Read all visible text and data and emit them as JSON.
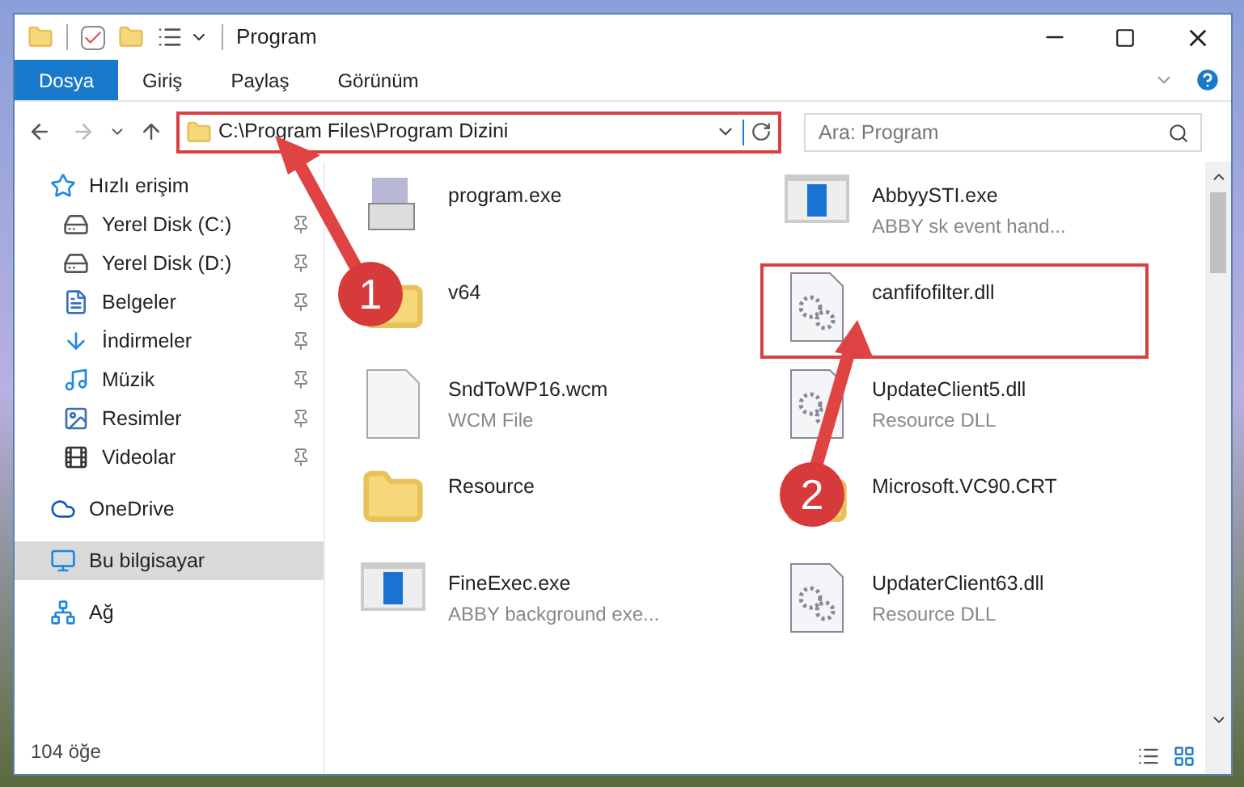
{
  "window": {
    "title": "Program"
  },
  "ribbon_tabs": [
    {
      "label": "Dosya",
      "selected": true
    },
    {
      "label": "Giriş",
      "selected": false
    },
    {
      "label": "Paylaş",
      "selected": false
    },
    {
      "label": "Görünüm",
      "selected": false
    }
  ],
  "address": {
    "path": "C:\\Program Files\\Program Dizini"
  },
  "search": {
    "placeholder": "Ara: Program"
  },
  "sidebar": {
    "items": [
      {
        "label": "Hızlı erişim",
        "kind": "star",
        "selected": false,
        "children": [
          {
            "label": "Yerel Disk (C:)",
            "kind": "disk",
            "pinned": true,
            "selected": false
          },
          {
            "label": "Yerel Disk (D:)",
            "kind": "disk",
            "pinned": true,
            "selected": false
          },
          {
            "label": "Belgeler",
            "kind": "doc",
            "pinned": true,
            "selected": false
          },
          {
            "label": "İndirmeler",
            "kind": "download",
            "pinned": true,
            "selected": false
          },
          {
            "label": "Müzik",
            "kind": "music",
            "pinned": true,
            "selected": false
          },
          {
            "label": "Resimler",
            "kind": "image",
            "pinned": true,
            "selected": false
          },
          {
            "label": "Videolar",
            "kind": "film",
            "pinned": true,
            "selected": false
          }
        ]
      },
      {
        "label": "OneDrive",
        "kind": "cloud",
        "selected": false
      },
      {
        "label": "Bu bilgisayar",
        "kind": "pc",
        "selected": true
      },
      {
        "label": "Ağ",
        "kind": "network",
        "selected": false
      }
    ]
  },
  "files": [
    {
      "name": "program.exe",
      "kind": "exe"
    },
    {
      "name": "AbbyySTI.exe",
      "type": "ABBY sk event hand...",
      "kind": "app"
    },
    {
      "name": "v64",
      "kind": "folder"
    },
    {
      "name": "canfifofilter.dll",
      "kind": "dll"
    },
    {
      "name": "SndToWP16.wcm",
      "type": "WCM File",
      "kind": "file"
    },
    {
      "name": "UpdateClient5.dll",
      "type": "Resource DLL",
      "kind": "dll"
    },
    {
      "name": "Resource",
      "kind": "folder"
    },
    {
      "name": "Microsoft.VC90.CRT",
      "kind": "folder"
    },
    {
      "name": "FineExec.exe",
      "type": "ABBY background exe...",
      "kind": "app"
    },
    {
      "name": "UpdaterClient63.dll",
      "type": "Resource DLL",
      "kind": "dll"
    }
  ],
  "status_bar": {
    "count": "104 öğe"
  },
  "annotations": [
    {
      "label": "1"
    },
    {
      "label": "2"
    }
  ]
}
